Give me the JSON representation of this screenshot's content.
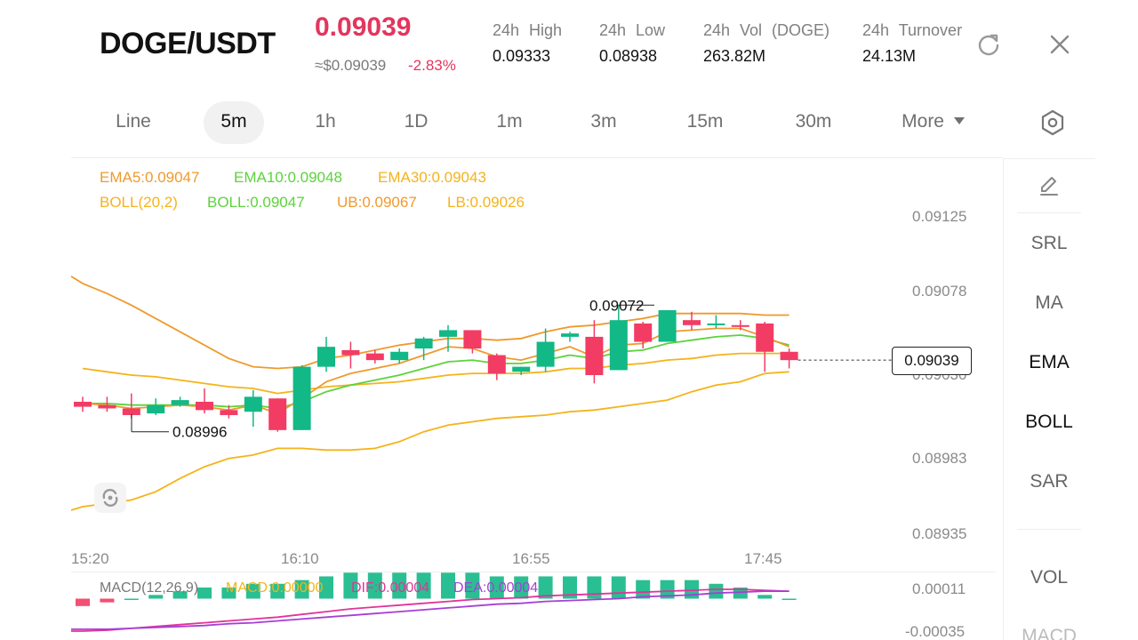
{
  "header": {
    "pair": "DOGE/USDT",
    "price": "0.09039",
    "approx": "≈$0.09039",
    "change": "-2.83%",
    "stats": [
      {
        "label": "24h High",
        "value": "0.09333"
      },
      {
        "label": "24h Low",
        "value": "0.08938"
      },
      {
        "label": "24h Vol (DOGE)",
        "value": "263.82M"
      },
      {
        "label": "24h Turnover",
        "value": "24.13M"
      }
    ],
    "icons": {
      "refresh": "refresh-icon",
      "close": "close-icon"
    }
  },
  "timeframes": {
    "tabs": [
      "Line",
      "5m",
      "1h",
      "1D",
      "1m",
      "3m",
      "15m",
      "30m"
    ],
    "active": "5m",
    "more": "More",
    "more_icon": "caret-down-icon",
    "settings_icon": "hexagon-settings-icon"
  },
  "legend": {
    "ema5": "EMA5:0.09047",
    "ema10": "EMA10:0.09048",
    "ema30": "EMA30:0.09043",
    "boll": "BOLL(20,2)",
    "boll_mid": "BOLL:0.09047",
    "ub": "UB:0.09067",
    "lb": "LB:0.09026",
    "macd": "MACD(12,26,9)",
    "macd_val": "MACD:0.00000",
    "dif": "DIF:0.00004",
    "dea": "DEA:0.00004"
  },
  "price_axis": [
    "0.09125",
    "0.09078",
    "0.09030",
    "0.08983",
    "0.08935"
  ],
  "macd_axis": [
    "0.00011",
    "-0.00035"
  ],
  "time_axis": [
    "15:20",
    "16:10",
    "16:55",
    "17:45"
  ],
  "annotations": {
    "high": "0.09072",
    "low": "0.08996",
    "last": "0.09039"
  },
  "indicators": {
    "edit_icon": "pencil-icon",
    "items": [
      "SRL",
      "MA",
      "EMA",
      "BOLL",
      "SAR"
    ],
    "active": [
      "EMA",
      "BOLL"
    ],
    "sub_items": [
      "VOL",
      "MACD"
    ]
  },
  "colors": {
    "up": "#12b886",
    "down": "#f23c64",
    "ema5": "#ef9a2d",
    "ema10": "#5cd33b",
    "ema30": "#f5b31b",
    "macd_dif": "#e2339a",
    "macd_dea": "#a63fd6"
  },
  "chart_data": {
    "type": "candlestick",
    "y_range": [
      0.08935,
      0.09125
    ],
    "candles": [
      {
        "o": 0.09014,
        "h": 0.09017,
        "l": 0.09008,
        "c": 0.09011
      },
      {
        "o": 0.09012,
        "h": 0.09017,
        "l": 0.09008,
        "c": 0.0901
      },
      {
        "o": 0.0901,
        "h": 0.09019,
        "l": 0.09004,
        "c": 0.09006
      },
      {
        "o": 0.09007,
        "h": 0.09016,
        "l": 0.09006,
        "c": 0.09012
      },
      {
        "o": 0.09012,
        "h": 0.09017,
        "l": 0.09011,
        "c": 0.09015
      },
      {
        "o": 0.09014,
        "h": 0.09022,
        "l": 0.09007,
        "c": 0.09009
      },
      {
        "o": 0.09009,
        "h": 0.09012,
        "l": 0.09004,
        "c": 0.09006
      },
      {
        "o": 0.09008,
        "h": 0.09021,
        "l": 0.08999,
        "c": 0.09017
      },
      {
        "o": 0.09016,
        "h": 0.09016,
        "l": 0.08996,
        "c": 0.08997
      },
      {
        "o": 0.08997,
        "h": 0.09036,
        "l": 0.08997,
        "c": 0.09035
      },
      {
        "o": 0.09035,
        "h": 0.09053,
        "l": 0.09032,
        "c": 0.09047
      },
      {
        "o": 0.09045,
        "h": 0.0905,
        "l": 0.09034,
        "c": 0.09042
      },
      {
        "o": 0.09043,
        "h": 0.09045,
        "l": 0.09037,
        "c": 0.09039
      },
      {
        "o": 0.09039,
        "h": 0.09046,
        "l": 0.09037,
        "c": 0.09044
      },
      {
        "o": 0.09046,
        "h": 0.09053,
        "l": 0.09039,
        "c": 0.09052
      },
      {
        "o": 0.09053,
        "h": 0.0906,
        "l": 0.09044,
        "c": 0.09057
      },
      {
        "o": 0.09057,
        "h": 0.09057,
        "l": 0.09043,
        "c": 0.09046
      },
      {
        "o": 0.09042,
        "h": 0.09043,
        "l": 0.09027,
        "c": 0.09031
      },
      {
        "o": 0.09032,
        "h": 0.09035,
        "l": 0.0903,
        "c": 0.09035
      },
      {
        "o": 0.09035,
        "h": 0.09058,
        "l": 0.09032,
        "c": 0.0905
      },
      {
        "o": 0.09053,
        "h": 0.09056,
        "l": 0.0905,
        "c": 0.09055
      },
      {
        "o": 0.09053,
        "h": 0.09063,
        "l": 0.09025,
        "c": 0.0903
      },
      {
        "o": 0.09033,
        "h": 0.09072,
        "l": 0.09033,
        "c": 0.09063
      },
      {
        "o": 0.09061,
        "h": 0.09062,
        "l": 0.09046,
        "c": 0.0905
      },
      {
        "o": 0.0905,
        "h": 0.09069,
        "l": 0.0905,
        "c": 0.09069
      },
      {
        "o": 0.09063,
        "h": 0.09068,
        "l": 0.09057,
        "c": 0.0906
      },
      {
        "o": 0.09061,
        "h": 0.09066,
        "l": 0.09058,
        "c": 0.09061
      },
      {
        "o": 0.0906,
        "h": 0.09063,
        "l": 0.09057,
        "c": 0.09059
      },
      {
        "o": 0.09061,
        "h": 0.09062,
        "l": 0.09032,
        "c": 0.09044
      },
      {
        "o": 0.09044,
        "h": 0.09046,
        "l": 0.09034,
        "c": 0.09039
      }
    ],
    "ema5": [
      0.09013,
      0.09012,
      0.0901,
      0.09011,
      0.09012,
      0.09011,
      0.09009,
      0.09012,
      0.09007,
      0.09016,
      0.09026,
      0.09031,
      0.09034,
      0.09037,
      0.09042,
      0.09047,
      0.09046,
      0.09041,
      0.09039,
      0.09043,
      0.09047,
      0.09041,
      0.09048,
      0.09049,
      0.09056,
      0.09057,
      0.09058,
      0.09058,
      0.09053,
      0.09047
    ],
    "ema10": [
      0.09013,
      0.09013,
      0.09012,
      0.09012,
      0.09012,
      0.09012,
      0.09011,
      0.09012,
      0.0901,
      0.09014,
      0.0902,
      0.09024,
      0.09027,
      0.0903,
      0.09034,
      0.09038,
      0.09039,
      0.09037,
      0.09037,
      0.09039,
      0.09042,
      0.0904,
      0.09044,
      0.09045,
      0.09049,
      0.09051,
      0.09053,
      0.09054,
      0.09052,
      0.09048
    ],
    "ema30": [
      0.09034,
      0.09032,
      0.0903,
      0.09029,
      0.09027,
      0.09025,
      0.09023,
      0.09022,
      0.09019,
      0.09021,
      0.09023,
      0.09024,
      0.09025,
      0.09026,
      0.09028,
      0.0903,
      0.09031,
      0.09031,
      0.09031,
      0.09032,
      0.09034,
      0.09034,
      0.09036,
      0.09037,
      0.09039,
      0.0904,
      0.09042,
      0.09043,
      0.09043,
      0.09043
    ],
    "boll_ub": [
      0.09085,
      0.09079,
      0.09072,
      0.09064,
      0.09056,
      0.09048,
      0.0904,
      0.09035,
      0.09034,
      0.09035,
      0.0904,
      0.09042,
      0.09045,
      0.09048,
      0.0905,
      0.09052,
      0.09052,
      0.09051,
      0.09052,
      0.09056,
      0.09059,
      0.0906,
      0.09062,
      0.09064,
      0.09067,
      0.09067,
      0.09067,
      0.09067,
      0.09066,
      0.09066
    ],
    "boll_lb": [
      0.08951,
      0.08953,
      0.08955,
      0.0896,
      0.08968,
      0.08975,
      0.0898,
      0.08982,
      0.08986,
      0.08986,
      0.08985,
      0.08985,
      0.08986,
      0.0899,
      0.08996,
      0.09,
      0.09002,
      0.09004,
      0.09005,
      0.09006,
      0.09008,
      0.09009,
      0.09011,
      0.09013,
      0.09015,
      0.0902,
      0.09024,
      0.09026,
      0.09031,
      0.09032
    ],
    "macd_dif": [
      -0.00035,
      -0.00034,
      -0.00032,
      -0.0003,
      -0.00028,
      -0.00026,
      -0.00024,
      -0.00022,
      -0.0002,
      -0.00017,
      -0.00014,
      -0.00011,
      -9e-05,
      -7e-05,
      -5e-05,
      -3e-05,
      -1e-05,
      0.0,
      1e-05,
      3e-05,
      4e-05,
      5e-05,
      6e-05,
      7e-05,
      8e-05,
      9e-05,
      0.0001,
      0.0001,
      9e-05,
      8e-05
    ],
    "macd_dea": [
      -0.00033,
      -0.00033,
      -0.00032,
      -0.00031,
      -0.0003,
      -0.00029,
      -0.00027,
      -0.00026,
      -0.00024,
      -0.00022,
      -0.0002,
      -0.00018,
      -0.00016,
      -0.00014,
      -0.00012,
      -0.0001,
      -8e-05,
      -6e-05,
      -5e-05,
      -3e-05,
      -2e-05,
      -1e-05,
      0.0,
      2e-05,
      3e-05,
      4e-05,
      6e-05,
      7e-05,
      8e-05,
      8e-05
    ],
    "macd_range": [
      -0.00035,
      0.00011
    ]
  }
}
